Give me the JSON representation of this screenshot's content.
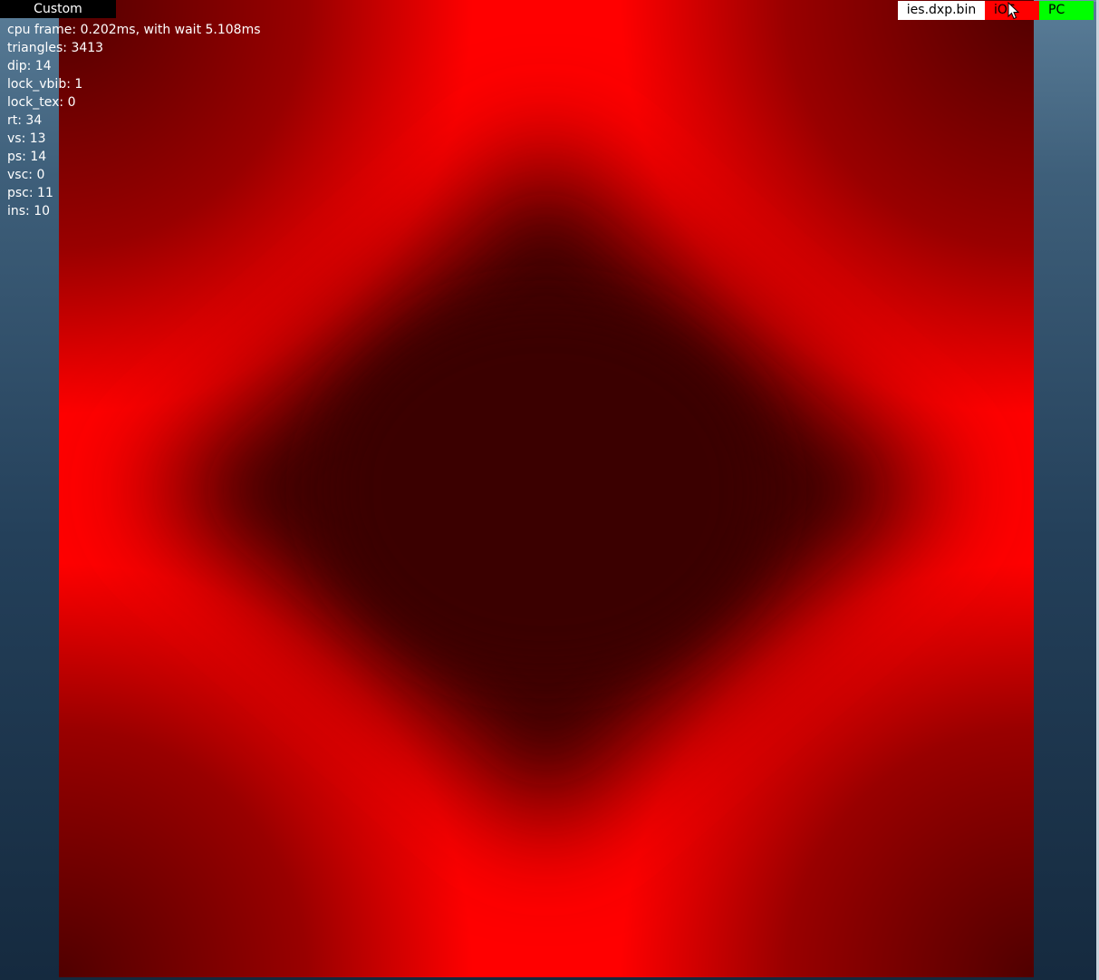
{
  "tab": {
    "label": "Custom"
  },
  "stats": [
    "cpu frame: 0.202ms, with wait 5.108ms",
    "triangles: 3413",
    "dip: 14",
    "lock_vbib: 1",
    "lock_tex: 0",
    "rt: 34",
    "vs: 13",
    "ps: 14",
    "vsc: 0",
    "psc: 11",
    "ins: 10"
  ],
  "toolbar": {
    "file_label": "ies.dxp.bin",
    "ios_label": "iOS",
    "pc_label": "PC"
  },
  "colors": {
    "render_red": "#ff0000",
    "render_dark": "#400000",
    "ios_button": "#ff0000",
    "pc_button": "#00ff00",
    "background_top": "#5a7d98",
    "background_bottom": "#152a3f"
  },
  "icons": {
    "cursor": "mouse-pointer-icon"
  }
}
